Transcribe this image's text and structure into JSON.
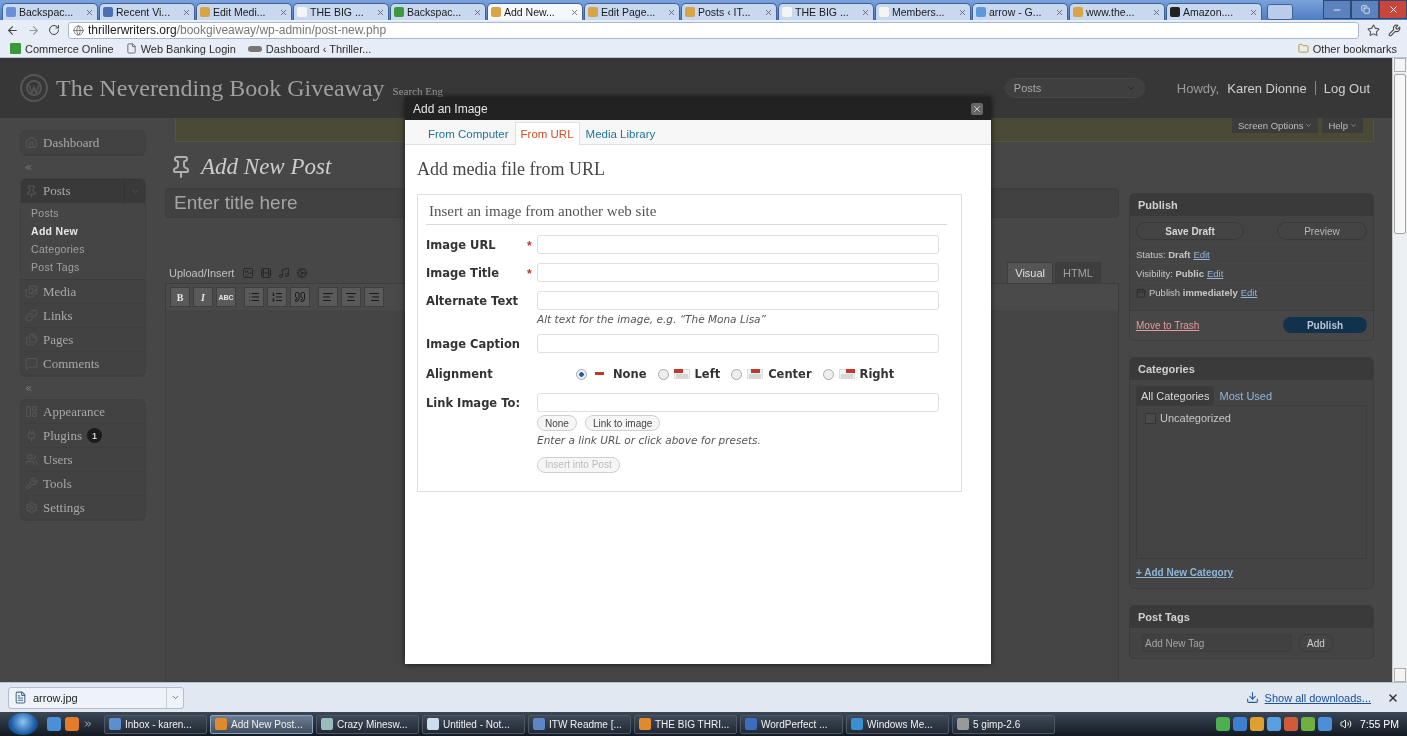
{
  "browser": {
    "tabs": [
      {
        "title": "Backspac...",
        "selected": false
      },
      {
        "title": "Recent Vi...",
        "selected": false
      },
      {
        "title": "Edit Medi...",
        "selected": false
      },
      {
        "title": "THE BIG ...",
        "selected": false
      },
      {
        "title": "Backspac...",
        "selected": false
      },
      {
        "title": "Add New...",
        "selected": true
      },
      {
        "title": "Edit Page...",
        "selected": false
      },
      {
        "title": "Posts ‹ IT...",
        "selected": false
      },
      {
        "title": "THE BIG ...",
        "selected": false
      },
      {
        "title": "Members...",
        "selected": false
      },
      {
        "title": "arrow - G...",
        "selected": false
      },
      {
        "title": "www.the...",
        "selected": false
      },
      {
        "title": "Amazon....",
        "selected": false
      }
    ],
    "url": {
      "host": "thrillerwriters.org",
      "path": "/bookgiveaway/wp-admin/post-new.php"
    },
    "bookmarks": [
      {
        "label": "Commerce Online",
        "kind": "bank"
      },
      {
        "label": "Web Banking Login",
        "kind": "page"
      },
      {
        "label": "Dashboard ‹ Thriller...",
        "kind": "site"
      }
    ],
    "other_bookmarks": "Other bookmarks"
  },
  "wp": {
    "site_title": "The Neverending Book Giveaway",
    "site_tagline": "Search Eng",
    "header_dropdown": "Posts",
    "howdy": "Howdy,",
    "user": "Karen Dionne",
    "logout": "Log Out",
    "screen_options": "Screen Options",
    "help": "Help",
    "menu": [
      [
        {
          "label": "Dashboard"
        }
      ],
      [
        {
          "label": "Posts",
          "expanded": true,
          "children": [
            {
              "label": "Posts",
              "selected": false
            },
            {
              "label": "Add New",
              "selected": true
            },
            {
              "label": "Categories",
              "selected": false
            },
            {
              "label": "Post Tags",
              "selected": false
            }
          ]
        },
        {
          "label": "Media"
        },
        {
          "label": "Links"
        },
        {
          "label": "Pages"
        },
        {
          "label": "Comments"
        }
      ],
      [
        {
          "label": "Appearance"
        },
        {
          "label": "Plugins",
          "badge": "1"
        },
        {
          "label": "Users"
        },
        {
          "label": "Tools"
        },
        {
          "label": "Settings"
        }
      ]
    ],
    "heading": "Add New Post",
    "title_placeholder": "Enter title here",
    "upload_insert": "Upload/Insert",
    "editor_tabs": [
      {
        "label": "Visual",
        "selected": true
      },
      {
        "label": "HTML",
        "selected": false
      }
    ],
    "toolbar": [
      {
        "kind": "bold",
        "label": "B"
      },
      {
        "kind": "italic",
        "label": "I"
      },
      {
        "kind": "strike",
        "label": "ABC"
      },
      {
        "kind": "bullets"
      },
      {
        "kind": "numbers"
      },
      {
        "kind": "quote"
      },
      {
        "kind": "align-left"
      },
      {
        "kind": "align-center"
      },
      {
        "kind": "align-right"
      }
    ],
    "publish": {
      "title": "Publish",
      "save_draft": "Save Draft",
      "preview": "Preview",
      "rows": [
        {
          "kind": "field",
          "label": "Status:",
          "value": "Draft",
          "link": "Edit"
        },
        {
          "kind": "field",
          "label": "Visibility:",
          "value": "Public",
          "link": "Edit"
        },
        {
          "kind": "schedule",
          "label": "Publish",
          "value": "immediately",
          "link": "Edit"
        }
      ],
      "trash": "Move to Trash",
      "publish": "Publish"
    },
    "categories": {
      "title": "Categories",
      "tabs": [
        {
          "label": "All Categories",
          "selected": true
        },
        {
          "label": "Most Used",
          "selected": false
        }
      ],
      "items": [
        {
          "label": "Uncategorized",
          "checked": false
        }
      ],
      "add_link": "+ Add New Category"
    },
    "post_tags": {
      "title": "Post Tags",
      "placeholder": "Add New Tag",
      "add": "Add"
    }
  },
  "modal": {
    "title": "Add an Image",
    "tabs": [
      {
        "label": "From Computer",
        "selected": false
      },
      {
        "label": "From URL",
        "selected": true
      },
      {
        "label": "Media Library",
        "selected": false
      }
    ],
    "heading": "Add media file from URL",
    "legend": "Insert an image from another web site",
    "required_mark": "*",
    "fields": [
      {
        "label": "Image URL",
        "required": true
      },
      {
        "label": "Image Title",
        "required": true
      },
      {
        "label": "Alternate Text",
        "required": false,
        "hint": "Alt text for the image, e.g. “The Mona Lisa”"
      },
      {
        "label": "Image Caption",
        "required": false
      }
    ],
    "alignment": {
      "label": "Alignment",
      "options": [
        {
          "kind": "none",
          "label": "None",
          "selected": true
        },
        {
          "kind": "left",
          "label": "Left",
          "selected": false
        },
        {
          "kind": "center",
          "label": "Center",
          "selected": false
        },
        {
          "kind": "right",
          "label": "Right",
          "selected": false
        }
      ]
    },
    "link": {
      "label": "Link Image To:",
      "buttons": [
        "None",
        "Link to image"
      ],
      "hint": "Enter a link URL or click above for presets."
    },
    "insert": {
      "label": "Insert into Post",
      "disabled": true
    }
  },
  "downloads": {
    "item": "arrow.jpg",
    "show_all": "Show all downloads..."
  },
  "taskbar": {
    "tasks": [
      {
        "label": "Inbox - karen...",
        "selected": false
      },
      {
        "label": "Add New Post...",
        "selected": true
      },
      {
        "label": "Crazy Minesw...",
        "selected": false
      },
      {
        "label": "Untitled - Not...",
        "selected": false
      },
      {
        "label": "ITW Readme [...",
        "selected": false
      },
      {
        "label": "THE BIG THRI...",
        "selected": false
      },
      {
        "label": "WordPerfect ...",
        "selected": false
      },
      {
        "label": "Windows Me...",
        "selected": false
      },
      {
        "label": "5 gimp-2.6",
        "selected": false
      }
    ],
    "clock": "7:55 PM"
  }
}
